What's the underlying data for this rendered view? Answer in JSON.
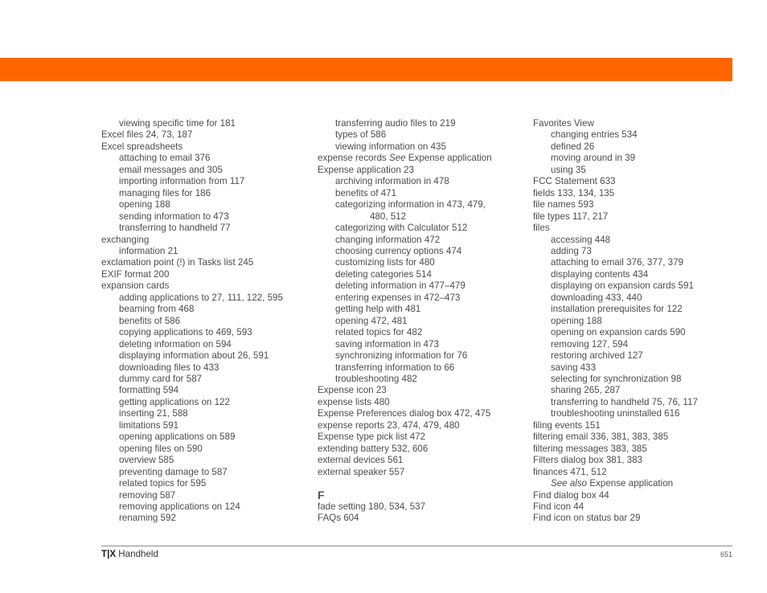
{
  "document": {
    "accent_color": "#ff6600",
    "footer": {
      "brand": "T|X",
      "product": "Handheld",
      "page_number": "651"
    },
    "columns": [
      {
        "entries": [
          {
            "level": 1,
            "text": "viewing specific time for 181"
          },
          {
            "level": 0,
            "text": "Excel files 24, 73, 187"
          },
          {
            "level": 0,
            "text": "Excel spreadsheets"
          },
          {
            "level": 1,
            "text": "attaching to email 376"
          },
          {
            "level": 1,
            "text": "email messages and 305"
          },
          {
            "level": 1,
            "text": "importing information from 117"
          },
          {
            "level": 1,
            "text": "managing files for 186"
          },
          {
            "level": 1,
            "text": "opening 188"
          },
          {
            "level": 1,
            "text": "sending information to 473"
          },
          {
            "level": 1,
            "text": "transferring to handheld 77"
          },
          {
            "level": 0,
            "text": "exchanging"
          },
          {
            "level": 1,
            "text": "information 21"
          },
          {
            "level": 0,
            "text": "exclamation point (!) in Tasks list 245"
          },
          {
            "level": 0,
            "text": "EXIF format 200"
          },
          {
            "level": 0,
            "text": "expansion cards"
          },
          {
            "level": 1,
            "text": "adding applications to 27, 111, 122, 595"
          },
          {
            "level": 1,
            "text": "beaming from 468"
          },
          {
            "level": 1,
            "text": "benefits of 586"
          },
          {
            "level": 1,
            "text": "copying applications to 469, 593"
          },
          {
            "level": 1,
            "text": "deleting information on 594"
          },
          {
            "level": 1,
            "text": "displaying information about 26, 591"
          },
          {
            "level": 1,
            "text": "downloading files to 433"
          },
          {
            "level": 1,
            "text": "dummy card for 587"
          },
          {
            "level": 1,
            "text": "formatting 594"
          },
          {
            "level": 1,
            "text": "getting applications on 122"
          },
          {
            "level": 1,
            "text": "inserting 21, 588"
          },
          {
            "level": 1,
            "text": "limitations 591"
          },
          {
            "level": 1,
            "text": "opening applications on 589"
          },
          {
            "level": 1,
            "text": "opening files on 590"
          },
          {
            "level": 1,
            "text": "overview 585"
          },
          {
            "level": 1,
            "text": "preventing damage to 587"
          },
          {
            "level": 1,
            "text": "related topics for 595"
          },
          {
            "level": 1,
            "text": "removing 587"
          },
          {
            "level": 1,
            "text": "removing applications on 124"
          },
          {
            "level": 1,
            "text": "renaming 592"
          }
        ]
      },
      {
        "entries": [
          {
            "level": 1,
            "text": "transferring audio files to 219"
          },
          {
            "level": 1,
            "text": "types of 586"
          },
          {
            "level": 1,
            "text": "viewing information on 435"
          },
          {
            "level": 0,
            "text": "expense records ",
            "see": "See",
            "after": " Expense application"
          },
          {
            "level": 0,
            "text": "Expense application 23"
          },
          {
            "level": 1,
            "text": "archiving information in 478"
          },
          {
            "level": 1,
            "text": "benefits of 471"
          },
          {
            "level": 1,
            "text": "categorizing information in 473, 479,"
          },
          {
            "level": 2,
            "text": "480, 512"
          },
          {
            "level": 1,
            "text": "categorizing with Calculator 512"
          },
          {
            "level": 1,
            "text": "changing information 472"
          },
          {
            "level": 1,
            "text": "choosing currency options 474"
          },
          {
            "level": 1,
            "text": "customizing lists for 480"
          },
          {
            "level": 1,
            "text": "deleting categories 514"
          },
          {
            "level": 1,
            "text": "deleting information in 477–479"
          },
          {
            "level": 1,
            "text": "entering expenses in 472–473"
          },
          {
            "level": 1,
            "text": "getting help with 481"
          },
          {
            "level": 1,
            "text": "opening 472, 481"
          },
          {
            "level": 1,
            "text": "related topics for 482"
          },
          {
            "level": 1,
            "text": "saving information in 473"
          },
          {
            "level": 1,
            "text": "synchronizing information for 76"
          },
          {
            "level": 1,
            "text": "transferring information to 66"
          },
          {
            "level": 1,
            "text": "troubleshooting 482"
          },
          {
            "level": 0,
            "text": "Expense icon 23"
          },
          {
            "level": 0,
            "text": "expense lists 480"
          },
          {
            "level": 0,
            "text": "Expense Preferences dialog box 472, 475"
          },
          {
            "level": 0,
            "text": "expense reports 23, 474, 479, 480"
          },
          {
            "level": 0,
            "text": "Expense type pick list 472"
          },
          {
            "level": 0,
            "text": "extending battery 532, 606"
          },
          {
            "level": 0,
            "text": "external devices 561"
          },
          {
            "level": 0,
            "text": "external speaker 557"
          },
          {
            "level": "heading",
            "text": "F"
          },
          {
            "level": 0,
            "text": "fade setting 180, 534, 537"
          },
          {
            "level": 0,
            "text": "FAQs 604"
          }
        ]
      },
      {
        "entries": [
          {
            "level": 0,
            "text": "Favorites View"
          },
          {
            "level": 1,
            "text": "changing entries 534"
          },
          {
            "level": 1,
            "text": "defined 26"
          },
          {
            "level": 1,
            "text": "moving around in 39"
          },
          {
            "level": 1,
            "text": "using 35"
          },
          {
            "level": 0,
            "text": "FCC Statement 633"
          },
          {
            "level": 0,
            "text": "fields 133, 134, 135"
          },
          {
            "level": 0,
            "text": "file names 593"
          },
          {
            "level": 0,
            "text": "file types 117, 217"
          },
          {
            "level": 0,
            "text": "files"
          },
          {
            "level": 1,
            "text": "accessing 448"
          },
          {
            "level": 1,
            "text": "adding 73"
          },
          {
            "level": 1,
            "text": "attaching to email 376, 377, 379"
          },
          {
            "level": 1,
            "text": "displaying contents 434"
          },
          {
            "level": 1,
            "text": "displaying on expansion cards 591"
          },
          {
            "level": 1,
            "text": "downloading 433, 440"
          },
          {
            "level": 1,
            "text": "installation prerequisites for 122"
          },
          {
            "level": 1,
            "text": "opening 188"
          },
          {
            "level": 1,
            "text": "opening on expansion cards 590"
          },
          {
            "level": 1,
            "text": "removing 127, 594"
          },
          {
            "level": 1,
            "text": "restoring archived 127"
          },
          {
            "level": 1,
            "text": "saving 433"
          },
          {
            "level": 1,
            "text": "selecting for synchronization 98"
          },
          {
            "level": 1,
            "text": "sharing 265, 287"
          },
          {
            "level": 1,
            "text": "transferring to handheld 75, 76, 117"
          },
          {
            "level": 1,
            "text": "troubleshooting uninstalled 616"
          },
          {
            "level": 0,
            "text": "filing events 151"
          },
          {
            "level": 0,
            "text": "filtering email 336, 381, 383, 385"
          },
          {
            "level": 0,
            "text": "filtering messages 383, 385"
          },
          {
            "level": 0,
            "text": "Filters dialog box 381, 383"
          },
          {
            "level": 0,
            "text": "finances 471, 512"
          },
          {
            "level": 1,
            "text": "",
            "see": "See also",
            "after": " Expense application"
          },
          {
            "level": 0,
            "text": "Find dialog box 44"
          },
          {
            "level": 0,
            "text": "Find icon 44"
          },
          {
            "level": 0,
            "text": "Find icon on status bar 29"
          }
        ]
      }
    ]
  }
}
